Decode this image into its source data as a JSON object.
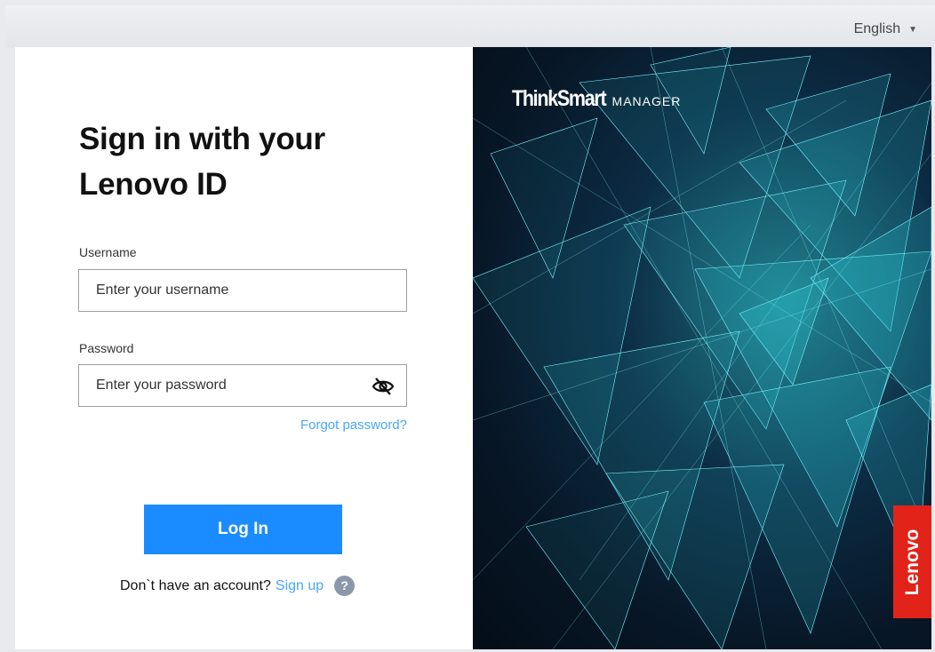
{
  "header": {
    "language": "English"
  },
  "signin": {
    "title_line1": "Sign in with your",
    "title_line2": "Lenovo ID",
    "username_label": "Username",
    "username_placeholder": "Enter your username",
    "password_label": "Password",
    "password_placeholder": "Enter your password",
    "forgot_password": "Forgot password?",
    "login_button": "Log In",
    "no_account_text": "Don`t have an account?",
    "signup_link": "Sign up",
    "help_symbol": "?"
  },
  "brand": {
    "product_name": "ThinkSmart",
    "product_suffix": "MANAGER",
    "company": "Lenovo"
  },
  "icons": {
    "language_caret": "chevron-down-icon",
    "password_toggle": "eye-slash-icon",
    "help": "question-icon"
  },
  "colors": {
    "primary_button": "#1a8cff",
    "link": "#4aa6f5",
    "lenovo_red": "#e2231a",
    "help_badge": "#8b98a9"
  }
}
